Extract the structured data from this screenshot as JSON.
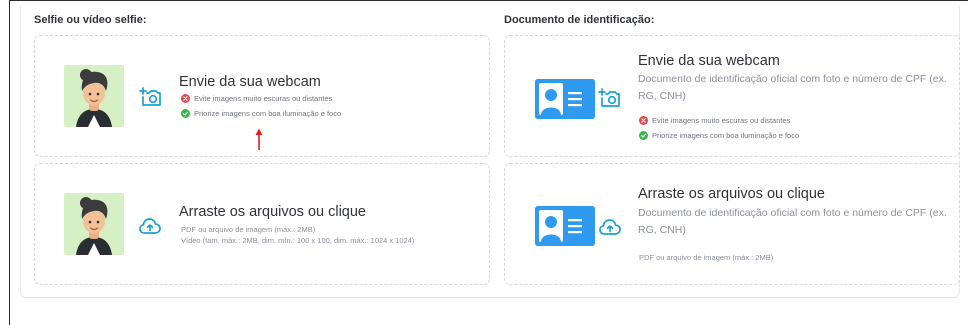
{
  "selfie": {
    "section_title": "Selfie ou vídeo selfie:",
    "webcam": {
      "title": "Envie da sua webcam",
      "rules": [
        {
          "status": "error",
          "text": "Evite imagens muito escuras ou distantes"
        },
        {
          "status": "ok",
          "text": "Priorize imagens com boa iluminação e foco"
        }
      ]
    },
    "upload": {
      "title": "Arraste os arquivos ou clique",
      "hint_1": "PDF ou arquivo de imagem (máx.: 2MB)",
      "hint_2": "Vídeo (tam. máx.: 2MB, dim. mín.: 100 x 100, dim. máx.: 1024 x 1024)"
    }
  },
  "document": {
    "section_title": "Documento de identificação:",
    "webcam": {
      "title": "Envie da sua webcam",
      "description": "Documento de identificação oficial com foto e número de CPF (ex. RG, CNH)",
      "rules": [
        {
          "status": "error",
          "text": "Evite imagens muito escuras ou distantes"
        },
        {
          "status": "ok",
          "text": "Priorize imagens com boa iluminação e foco"
        }
      ]
    },
    "upload": {
      "title": "Arraste os arquivos ou clique",
      "description": "Documento de identificação oficial com foto e número de CPF (ex. RG, CNH)",
      "hint": "PDF ou arquivo de imagem (máx.: 2MB)"
    }
  },
  "colors": {
    "accent_blue": "#2e9bf0",
    "icon_blue": "#1aa0d8",
    "error_red": "#e5484d",
    "ok_green": "#3bb54a",
    "avatar_bg": "#d6f0c5",
    "annotation_red": "#e02020"
  },
  "icons": {
    "webcam": "camera-plus-icon",
    "upload": "cloud-upload-icon",
    "error": "error-circle-icon",
    "ok": "check-circle-icon"
  }
}
